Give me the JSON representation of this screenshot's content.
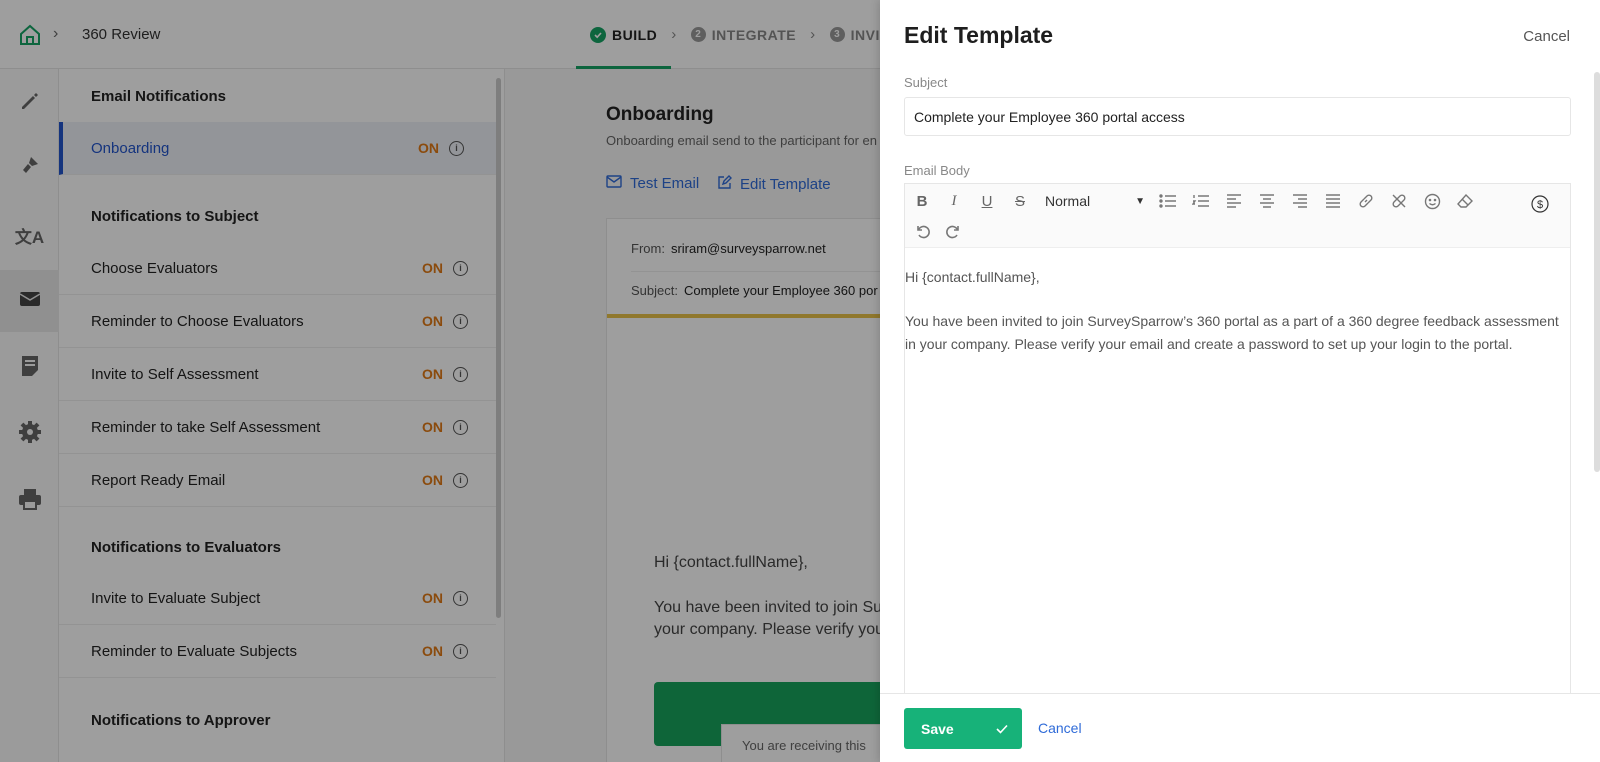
{
  "breadcrumb": {
    "home_icon": "home-icon",
    "page": "360 Review"
  },
  "steps": [
    {
      "label": "BUILD",
      "status": "done"
    },
    {
      "num": "2",
      "label": "INTEGRATE"
    },
    {
      "num": "3",
      "label": "INVITE"
    }
  ],
  "rail": [
    "pen-icon",
    "paint-brush-icon",
    "translate-icon",
    "mail-icon",
    "report-icon",
    "settings-icon",
    "print-icon"
  ],
  "notifications": {
    "group_email": "Email Notifications",
    "onboarding": {
      "label": "Onboarding",
      "status": "ON"
    },
    "group_subject": "Notifications to Subject",
    "subject_items": [
      {
        "label": "Choose Evaluators",
        "status": "ON"
      },
      {
        "label": "Reminder to Choose Evaluators",
        "status": "ON"
      },
      {
        "label": "Invite to Self Assessment",
        "status": "ON"
      },
      {
        "label": "Reminder to take Self Assessment",
        "status": "ON"
      },
      {
        "label": "Report Ready Email",
        "status": "ON"
      }
    ],
    "group_evaluators": "Notifications to Evaluators",
    "evaluator_items": [
      {
        "label": "Invite to Evaluate Subject",
        "status": "ON"
      },
      {
        "label": "Reminder to Evaluate Subjects",
        "status": "ON"
      }
    ],
    "group_approver": "Notifications to Approver"
  },
  "main": {
    "title": "Onboarding",
    "description": "Onboarding email send to the participant for en",
    "test_email": "Test Email",
    "edit_template": "Edit Template",
    "from_label": "From:",
    "from_value": "sriram@surveysparrow.net",
    "subject_label": "Subject:",
    "subject_value": "Complete your Employee 360 por",
    "greeting": "Hi {contact.fullName},",
    "body_line1": "You have been invited to join Su",
    "body_line2": "your company. Please verify you",
    "footer_text": "You are receiving this"
  },
  "drawer": {
    "title": "Edit Template",
    "cancel_top": "Cancel",
    "subject_label": "Subject",
    "subject_value": "Complete your Employee 360 portal access",
    "email_body_label": "Email Body",
    "format_select": "Normal",
    "body_greeting": "Hi {contact.fullName},",
    "body_text": "You have been invited to join SurveySparrow’s 360 portal as a part of a 360 degree feedback assessment in your company. Please verify your email and create a password to set up your login to the portal.",
    "save": "Save",
    "cancel": "Cancel"
  },
  "colors": {
    "accent_green": "#17b279",
    "link_blue": "#2f6bd8",
    "status_orange": "#e07a16"
  }
}
